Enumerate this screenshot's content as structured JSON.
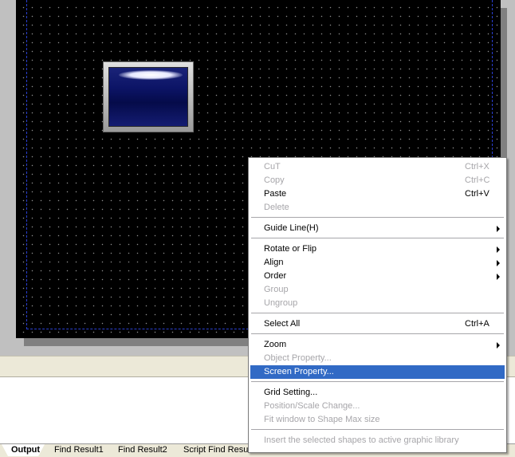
{
  "canvas": {
    "background": "#000000",
    "grid_dot_color": "#8c8c8c",
    "guide_color": "#2a3fd0"
  },
  "lamp": {
    "frame_color": "#c0c0c0",
    "lens_color": "#0c1466"
  },
  "menu": {
    "highlight_color": "#316ac5",
    "items": [
      {
        "label": "CuT",
        "shortcut": "Ctrl+X",
        "enabled": false
      },
      {
        "label": "Copy",
        "shortcut": "Ctrl+C",
        "enabled": false
      },
      {
        "label": "Paste",
        "shortcut": "Ctrl+V",
        "enabled": true
      },
      {
        "label": "Delete",
        "shortcut": "",
        "enabled": false
      },
      {
        "label": "Guide Line(H)",
        "submenu": true,
        "enabled": true
      },
      {
        "label": "Rotate or Flip",
        "submenu": true,
        "enabled": true
      },
      {
        "label": "Align",
        "submenu": true,
        "enabled": true
      },
      {
        "label": "Order",
        "submenu": true,
        "enabled": true
      },
      {
        "label": "Group",
        "enabled": false
      },
      {
        "label": "Ungroup",
        "enabled": false
      },
      {
        "label": "Select All",
        "shortcut": "Ctrl+A",
        "enabled": true
      },
      {
        "label": "Zoom",
        "submenu": true,
        "enabled": true
      },
      {
        "label": "Object Property...",
        "enabled": false
      },
      {
        "label": "Screen Property...",
        "enabled": true,
        "highlighted": true
      },
      {
        "label": "Grid Setting...",
        "enabled": true
      },
      {
        "label": "Position/Scale Change...",
        "enabled": false
      },
      {
        "label": "Fit window to Shape Max size",
        "enabled": false
      },
      {
        "label": "Insert the selected shapes to active graphic library",
        "enabled": false
      }
    ]
  },
  "output": {
    "tabs": [
      {
        "label": "Output",
        "active": true
      },
      {
        "label": "Find Result1",
        "active": false
      },
      {
        "label": "Find Result2",
        "active": false
      },
      {
        "label": "Script Find Result",
        "active": false
      }
    ]
  }
}
